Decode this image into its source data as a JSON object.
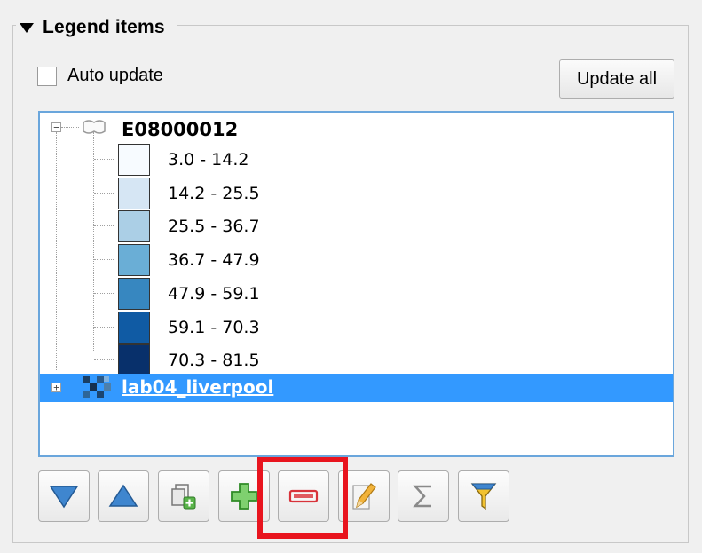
{
  "group": {
    "title": "Legend items"
  },
  "auto_update": {
    "label": "Auto update",
    "checked": false
  },
  "update_all_label": "Update all",
  "tree": {
    "layer_name": "E08000012",
    "legend": [
      {
        "label": "3.0 - 14.2",
        "color": "#f7fbff"
      },
      {
        "label": "14.2 - 25.5",
        "color": "#d6e6f4"
      },
      {
        "label": "25.5 - 36.7",
        "color": "#abcfe6"
      },
      {
        "label": "36.7 - 47.9",
        "color": "#6aaed6"
      },
      {
        "label": "47.9 - 59.1",
        "color": "#3787c0"
      },
      {
        "label": "59.1 - 70.3",
        "color": "#105ba4"
      },
      {
        "label": "70.3 - 81.5",
        "color": "#08306b"
      }
    ],
    "selected_layer": "lab04_liverpool",
    "selection_color": "#3399ff"
  },
  "toolbar": {
    "buttons": [
      {
        "icon": "move-down-icon"
      },
      {
        "icon": "move-up-icon"
      },
      {
        "icon": "add-group-icon"
      },
      {
        "icon": "add-item-icon"
      },
      {
        "icon": "remove-item-icon"
      },
      {
        "icon": "edit-icon"
      },
      {
        "icon": "sum-icon"
      },
      {
        "icon": "filter-icon"
      }
    ]
  },
  "highlight_color": "#e8141e"
}
